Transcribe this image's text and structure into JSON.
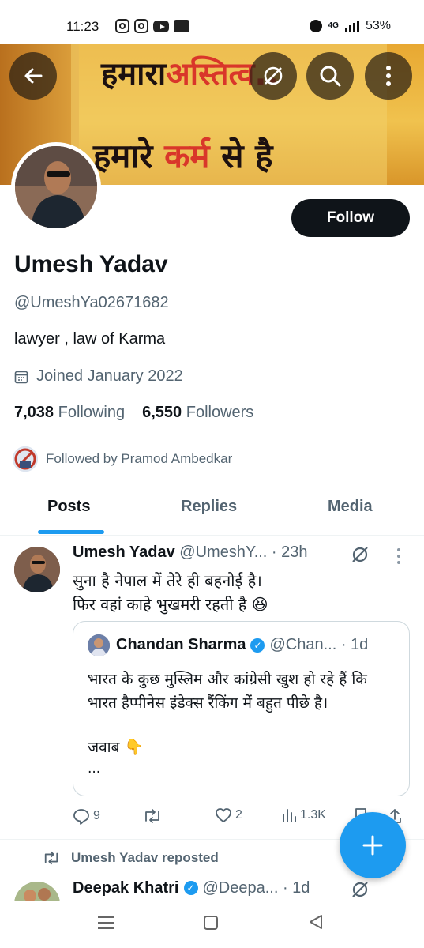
{
  "status_bar": {
    "time": "11:23",
    "network": "4G",
    "battery": "53%",
    "notification_icons": [
      "instagram-icon",
      "instagram-icon",
      "youtube-icon",
      "app-icon"
    ]
  },
  "banner": {
    "line1_black": "हमारा",
    "line1_red": "अस्तित्व..",
    "line2_black_a": "हमारे",
    "line2_red": "कर्म",
    "line2_black_b": "से है"
  },
  "profile": {
    "follow_label": "Follow",
    "name": "Umesh Yadav",
    "handle": "@UmeshYa02671682",
    "bio": "lawyer , law of Karma",
    "joined": "Joined January 2022",
    "following_count": "7,038",
    "following_label": "Following",
    "followers_count": "6,550",
    "followers_label": "Followers",
    "followed_by": "Followed by Pramod Ambedkar"
  },
  "tabs": [
    {
      "label": "Posts",
      "active": true
    },
    {
      "label": "Replies",
      "active": false
    },
    {
      "label": "Media",
      "active": false
    }
  ],
  "tweet": {
    "author": "Umesh Yadav",
    "handle_time": "@UmeshY... · 23h",
    "text_line1": "सुना है नेपाल में तेरे ही बहनोई है।",
    "text_line2": "फिर वहां काहे भुखमरी रहती है 😆",
    "quote": {
      "author": "Chandan Sharma",
      "handle_time": "@Chan... · 1d",
      "text": "भारत के कुछ मुस्लिम और कांग्रेसी खुश हो रहे हैं कि भारत हैप्पीनेस इंडेक्स रैंकिंग में बहुत पीछे है।",
      "answer": "जवाब 👇",
      "ellipsis": "..."
    },
    "replies": "9",
    "likes": "2",
    "views": "1.3K"
  },
  "second_tweet": {
    "repost_label": "Umesh Yadav reposted",
    "author": "Deepak Khatri",
    "handle_time": "@Deepa... · 1d"
  },
  "colors": {
    "accent": "#1d9bf0",
    "text": "#0f1419",
    "muted": "#536471",
    "banner_red": "#d9362a"
  }
}
